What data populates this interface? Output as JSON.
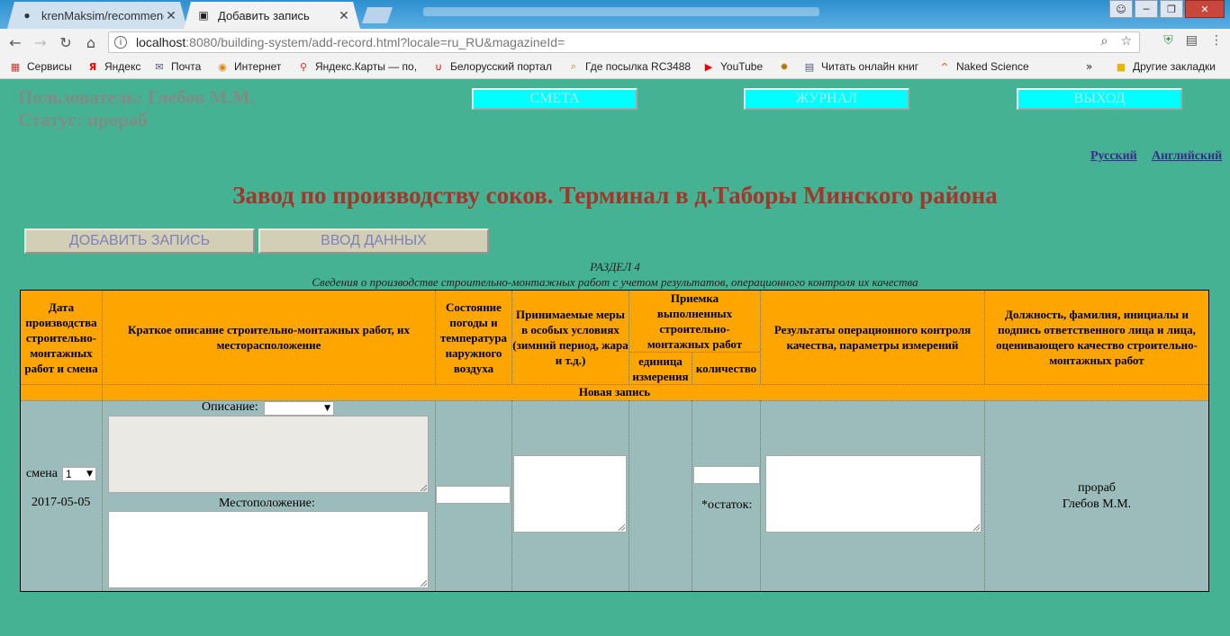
{
  "browser": {
    "tabs": [
      {
        "title": "krenMaksim/recommend",
        "favicon": "github-icon"
      },
      {
        "title": "Добавить запись",
        "favicon": "page-icon"
      }
    ],
    "url_host": "localhost",
    "url_rest": ":8080/building-system/add-record.html?locale=ru_RU&magazineId=",
    "bookmarks": [
      "Сервисы",
      "Яндекс",
      "Почта",
      "Интернет",
      "Яндекс.Карты — по,",
      "Белорусский портал",
      "Где посылка RC3488",
      "YouTube",
      "Читать онлайн книг",
      "Naked Science",
      "Другие закладки"
    ]
  },
  "user": {
    "name_line": "Пользователь: Глебов М.М.",
    "status_line": "Статус: прораб"
  },
  "nav": {
    "estimate": "СМЕТА",
    "journal": "ЖУРНАЛ",
    "logout": "ВЫХОД"
  },
  "lang": {
    "ru": "Русский",
    "en": "Английский"
  },
  "title": "Завод по производству соков. Терминал в д.Таборы Минского района",
  "actions": {
    "add_record": "ДОБАВИТЬ ЗАПИСЬ",
    "data_entry": "ВВОД ДАННЫХ"
  },
  "section": {
    "name": "РАЗДЕЛ 4",
    "subtitle": "Сведения о производстве строительно-монтажных работ с учетом результатов, операционного контроля их качества"
  },
  "table": {
    "headers": {
      "date": "Дата производства строительно-монтажных работ и смена",
      "description": "Краткое описание строительно-монтажных работ, их месторасположение",
      "weather": "Состояние погоды и температура наружного воздуха",
      "measures": "Принимаемые меры в особых условиях (зимний период, жара и т.д.)",
      "acceptance": "Приемка выполненных строительно-монтажных работ",
      "unit": "единица измерения",
      "quantity": "количество",
      "results": "Результаты операционного контроля качества, параметры измерений",
      "responsible": "Должность, фамилия, инициалы и подпись ответственного лица и лица, оценивающего качество строительно-монтажных работ"
    },
    "new_record_label": "Новая запись",
    "row": {
      "shift_label": "смена",
      "shift_value": "1",
      "date": "2017-05-05",
      "description_label": "Описание:",
      "location_label": "Местоположение:",
      "remainder_label": "*остаток:",
      "position": "прораб",
      "person": "Глебов М.М."
    }
  }
}
